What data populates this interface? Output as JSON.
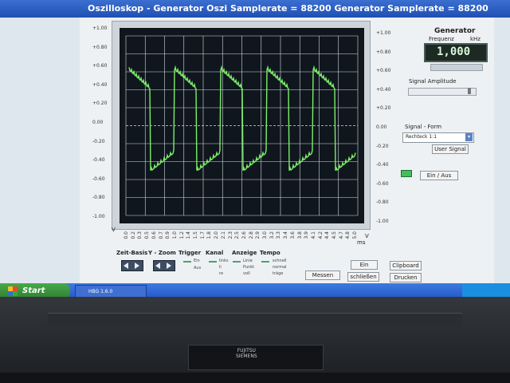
{
  "window": {
    "title": "Oszilloskop  -  Generator   Oszi Samplerate = 88200   Generator Samplerate = 88200"
  },
  "scope": {
    "y_left_ticks": [
      "+1.00",
      "+0.80",
      "+0.60",
      "+0.40",
      "+0.20",
      "0.00",
      "-0.20",
      "-0.40",
      "-0.60",
      "-0.80",
      "-1.00"
    ],
    "y_right_ticks": [
      "+1.00",
      "+0.80",
      "+0.60",
      "+0.40",
      "+0.20",
      "0.00",
      "-0.20",
      "-0.40",
      "-0.60",
      "-0.80",
      "-1.00"
    ],
    "x_ticks": [
      "0.0",
      "0.2",
      "0.3",
      "0.5",
      "0.6",
      "0.7",
      "0.9",
      "1.0",
      "1.2",
      "1.4",
      "1.5",
      "1.7",
      "1.8",
      "2.0",
      "2.1",
      "2.3",
      "2.5",
      "2.6",
      "2.8",
      "2.9",
      "3.0",
      "3.2",
      "3.3",
      "3.4",
      "3.6",
      "3.8",
      "3.9",
      "4.1",
      "4.2",
      "4.4",
      "4.5",
      "4.7",
      "4.8",
      "5.0"
    ],
    "v_label": "V",
    "ms_label": "ms",
    "trace_color": "#7cf06a",
    "grid_color": "#d7dde4",
    "background_color": "#10161d"
  },
  "controls": {
    "headers": [
      "Zeit-Basis",
      "Y - Zoom",
      "Trigger",
      "Kanal",
      "Anzeige",
      "Tempo"
    ],
    "trigger_options": [
      "Ein",
      "Aus"
    ],
    "kanal_options": [
      "links",
      "li",
      "re"
    ],
    "anzeige_options": [
      "Linie",
      "Punkt",
      "voll"
    ],
    "tempo_options": [
      "schnell",
      "normal",
      "träge"
    ],
    "messen_button": "Messen",
    "ein_button": "Ein",
    "schliessen_button": "schließen",
    "clipboard_button": "Clipboard",
    "drucken_button": "Drucken"
  },
  "generator": {
    "title": "Generator",
    "freq_label": "Frequenz",
    "freq_unit": "kHz",
    "freq_value": "1,000",
    "amplitude_label": "Signal Amplitude",
    "form_label": "Signal - Form",
    "form_value": "Rechteck 1:1",
    "user_signal_button": "User Signal",
    "ein_aus_button": "Ein / Aus"
  },
  "taskbar": {
    "start_label": "Start",
    "task_label": "HBG 1.6.0"
  },
  "laptop": {
    "brand": "FUJITSU\nSIEMENS"
  }
}
